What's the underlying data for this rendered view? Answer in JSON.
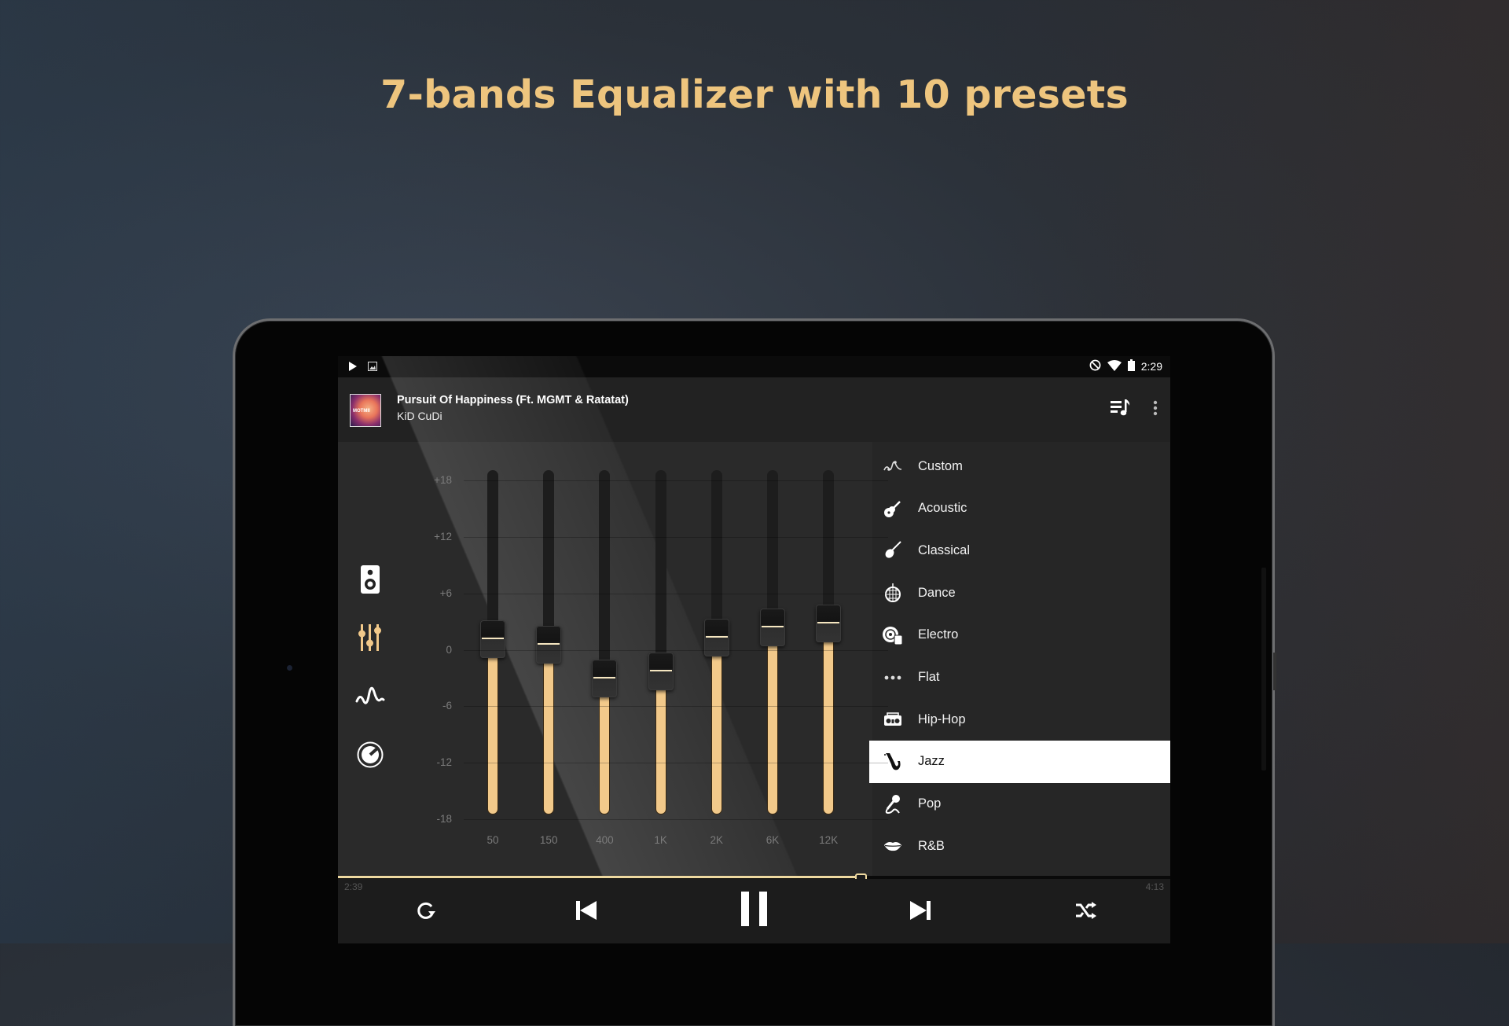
{
  "headline": "7-bands Equalizer with 10 presets",
  "statusbar": {
    "left_icons": [
      "play-notification-icon",
      "image-notification-icon"
    ],
    "right_icons": [
      "do-not-disturb-icon",
      "wifi-icon",
      "battery-icon"
    ],
    "time": "2:29"
  },
  "now_playing": {
    "title": "Pursuit Of Happiness (Ft. MGMT & Ratatat)",
    "artist": "KiD CuDi",
    "album_art_text": "MOTMII"
  },
  "header_actions": [
    "queue-music-icon",
    "more-vert-icon"
  ],
  "rail": [
    {
      "icon": "speaker-icon",
      "active": false
    },
    {
      "icon": "equalizer-sliders-icon",
      "active": true
    },
    {
      "icon": "wave-icon",
      "active": false
    },
    {
      "icon": "knob-icon",
      "active": false
    }
  ],
  "accent_color": "#f2c98a",
  "equalizer": {
    "db_labels": [
      "+18",
      "+12",
      "+6",
      "0",
      "-6",
      "-12",
      "-18"
    ],
    "range_db": [
      -18,
      18
    ],
    "bands": [
      {
        "freq": "50",
        "gain_db": 1.2
      },
      {
        "freq": "150",
        "gain_db": 0.6
      },
      {
        "freq": "400",
        "gain_db": -3.0
      },
      {
        "freq": "1K",
        "gain_db": -2.2
      },
      {
        "freq": "2K",
        "gain_db": 1.4
      },
      {
        "freq": "6K",
        "gain_db": 2.5
      },
      {
        "freq": "12K",
        "gain_db": 2.9
      }
    ]
  },
  "presets": {
    "selected": "Jazz",
    "items": [
      {
        "label": "Custom",
        "icon": "custom-curve-icon"
      },
      {
        "label": "Acoustic",
        "icon": "acoustic-guitar-icon"
      },
      {
        "label": "Classical",
        "icon": "violin-icon"
      },
      {
        "label": "Dance",
        "icon": "disco-ball-icon"
      },
      {
        "label": "Electro",
        "icon": "turntable-icon"
      },
      {
        "label": "Flat",
        "icon": "dots-icon"
      },
      {
        "label": "Hip-Hop",
        "icon": "boombox-icon"
      },
      {
        "label": "Jazz",
        "icon": "saxophone-icon"
      },
      {
        "label": "Pop",
        "icon": "microphone-icon"
      },
      {
        "label": "R&B",
        "icon": "lips-icon"
      }
    ]
  },
  "playback": {
    "elapsed": "2:39",
    "total": "4:13",
    "progress": 0.628,
    "controls": [
      "repeat-icon",
      "previous-icon",
      "pause-icon",
      "next-icon",
      "shuffle-icon"
    ]
  }
}
